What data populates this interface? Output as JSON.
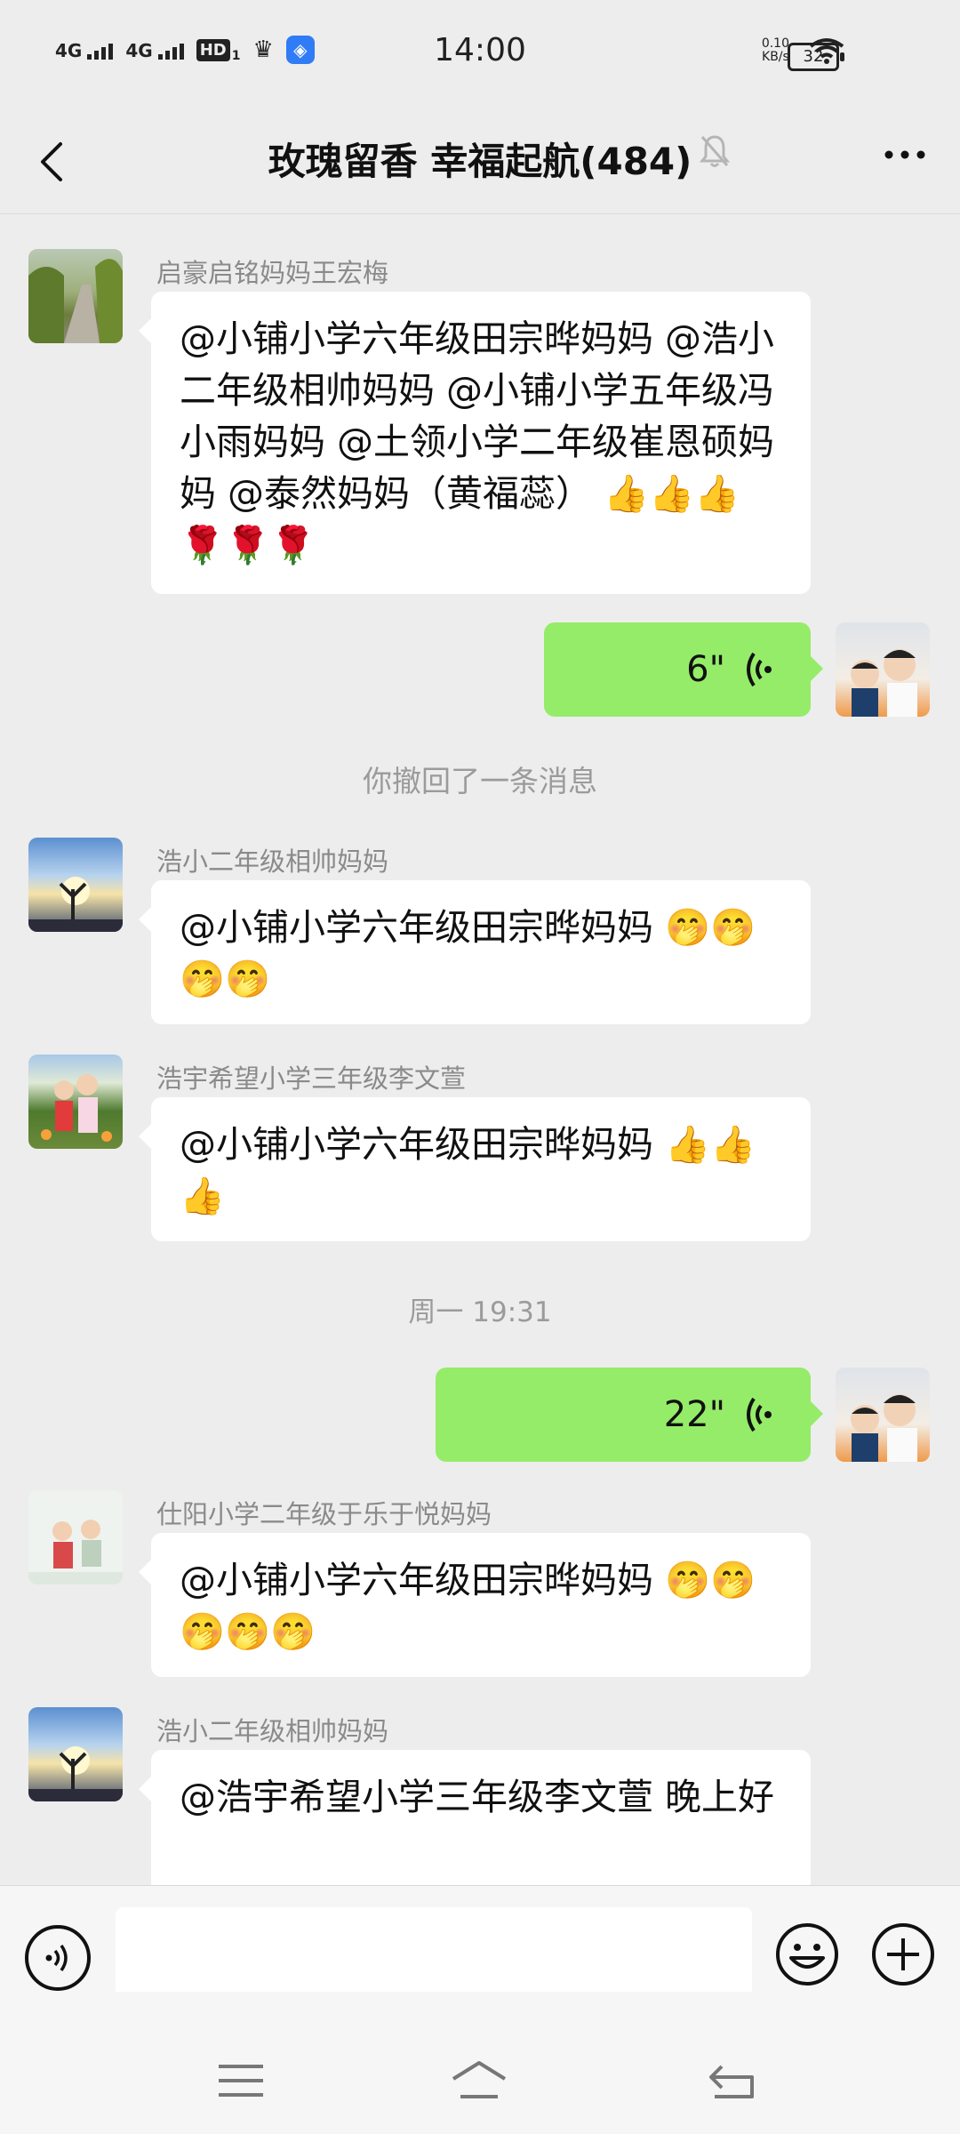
{
  "status_bar": {
    "network1": "4G",
    "network2": "4G",
    "hd": "HD",
    "hd_sub": "1",
    "time": "14:00",
    "speed_value": "0.10",
    "speed_unit": "KB/s",
    "battery": "32"
  },
  "header": {
    "title": "玫瑰留香  幸福起航(484)"
  },
  "messages": {
    "m1": {
      "sender": "启豪启铭妈妈王宏梅",
      "text": "@小铺小学六年级田宗晔妈妈 @浩小二年级相帅妈妈 @小铺小学五年级冯小雨妈妈 @土领小学二年级崔恩硕妈妈 @泰然妈妈（黄福蕊） 👍👍👍🌹🌹🌹"
    },
    "m2": {
      "duration": "6\""
    },
    "recalled": "你撤回了一条消息",
    "m3": {
      "sender": "浩小二年级相帅妈妈",
      "text": "@小铺小学六年级田宗晔妈妈  🤭🤭🤭🤭"
    },
    "m4": {
      "sender": "浩宇希望小学三年级李文萱",
      "text": "@小铺小学六年级田宗晔妈妈  👍👍👍"
    },
    "timestamp": "周一 19:31",
    "m5": {
      "duration": "22\""
    },
    "m6": {
      "sender": "仕阳小学二年级于乐于悦妈妈",
      "text": "@小铺小学六年级田宗晔妈妈  🤭🤭🤭🤭🤭"
    },
    "m7": {
      "sender": "浩小二年级相帅妈妈",
      "text": "@浩宇希望小学三年级李文萱  晚上好"
    }
  },
  "colors": {
    "background": "#ededed",
    "bubble_self": "#95ec69",
    "bubble_other": "#ffffff"
  }
}
